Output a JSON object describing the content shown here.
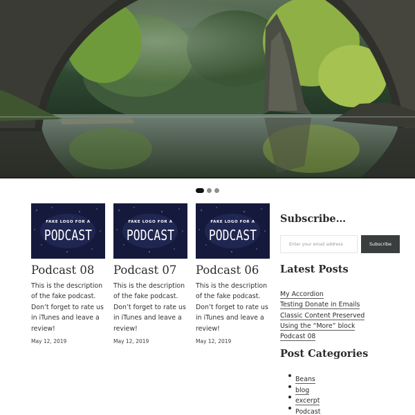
{
  "hero": {
    "image": "landscape photo: stone arch bridge over a still river, green trees reflected in the water",
    "slider_dots": [
      {
        "active": true
      },
      {
        "active": false
      },
      {
        "active": false
      }
    ]
  },
  "posts": [
    {
      "thumb_line1": "FAKE LOGO FOR A",
      "thumb_line2": "PODCAST",
      "title": "Podcast 08",
      "description": "This is the description of the fake podcast. Don’t forget to rate us in iTunes and leave a review!",
      "date": "May 12, 2019"
    },
    {
      "thumb_line1": "FAKE LOGO FOR A",
      "thumb_line2": "PODCAST",
      "title": "Podcast 07",
      "description": "This is the description of the fake podcast. Don’t forget to rate us in iTunes and leave a review!",
      "date": "May 12, 2019"
    },
    {
      "thumb_line1": "FAKE LOGO FOR A",
      "thumb_line2": "PODCAST",
      "title": "Podcast 06",
      "description": "This is the description of the fake podcast. Don’t forget to rate us in iTunes and leave a review!",
      "date": "May 12, 2019"
    }
  ],
  "sidebar": {
    "subscribe": {
      "title": "Subscribe…",
      "placeholder": "Enter your email address",
      "button_label": "Subscribe"
    },
    "latest_posts": {
      "title": "Latest Posts",
      "items": [
        "My Accordion",
        "Testing Donate in Emails",
        "Classic Content Preserved",
        "Using the “More” block",
        "Podcast 08"
      ]
    },
    "categories": {
      "title": "Post Categories",
      "items": [
        "Beans",
        "blog",
        "excerpt",
        "Podcast"
      ]
    }
  },
  "colors": {
    "button_bg": "#3a3e3f",
    "thumb_bg": "#151a3c",
    "text": "#2b2b2b"
  }
}
